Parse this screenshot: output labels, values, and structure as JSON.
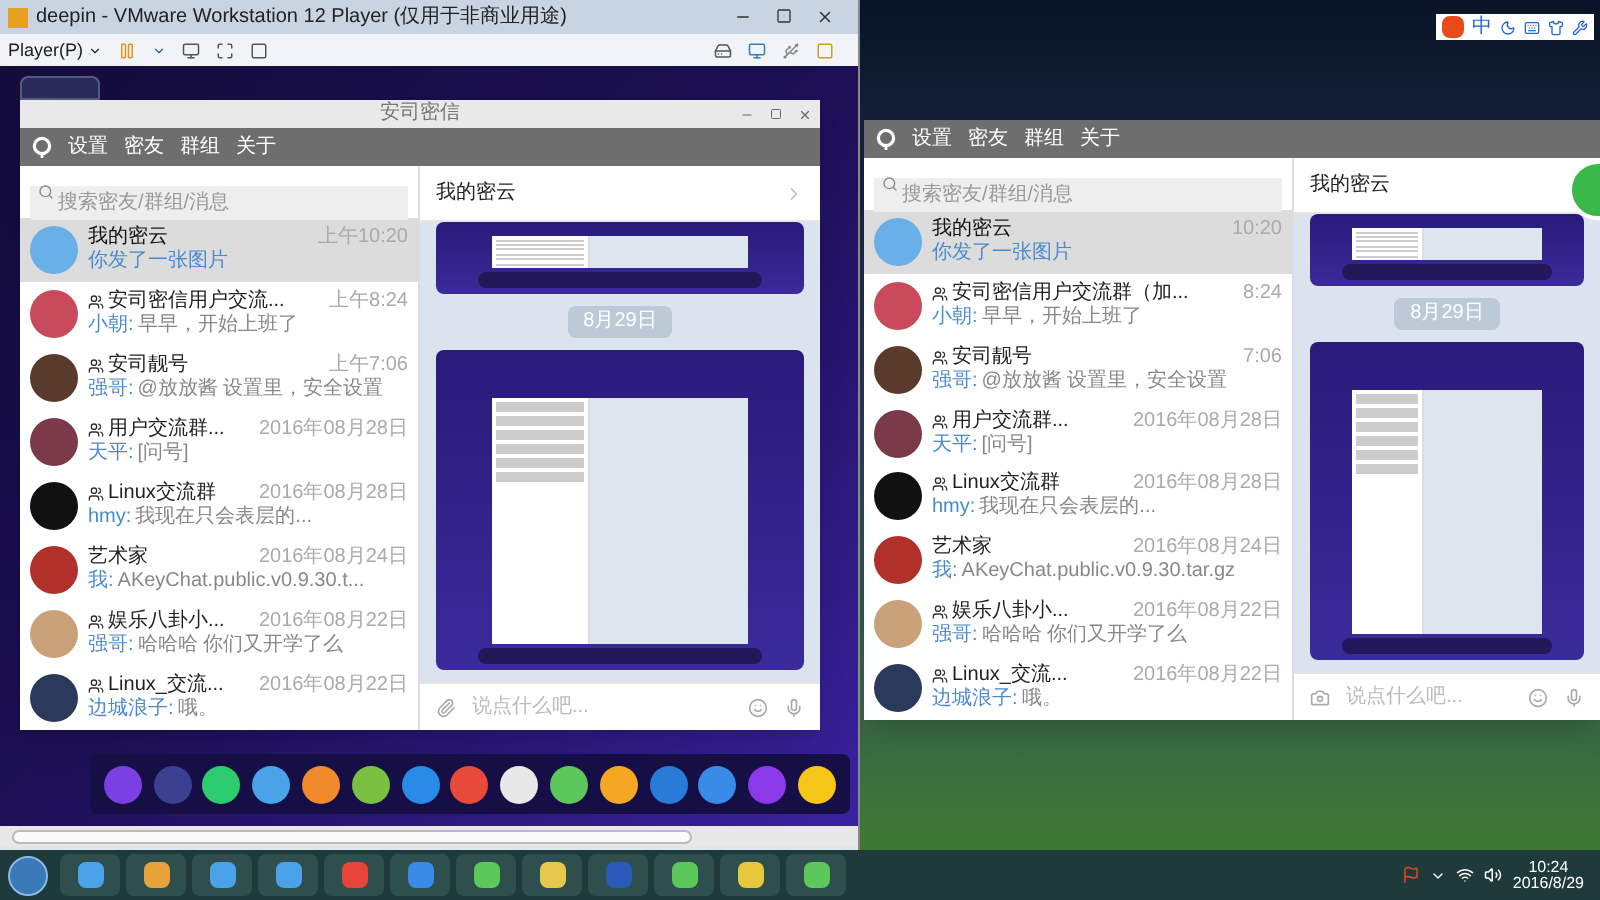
{
  "vmware_window": {
    "title": "deepin - VMware Workstation 12 Player (仅用于非商业用途)",
    "menu_label": "Player(P)"
  },
  "left_app": {
    "title": "安司密信",
    "menu": [
      "设置",
      "密友",
      "群组",
      "关于"
    ],
    "search": {
      "placeholder": "搜索密友/群组/消息"
    },
    "chats": [
      {
        "name": "我的密云",
        "group": false,
        "time": "上午10:20",
        "preview": "你发了一张图片",
        "selected": true
      },
      {
        "name": "安司密信用户交流...",
        "group": true,
        "time": "上午8:24",
        "sender": "小朝:",
        "preview": "早早，开始上班了",
        "selected": false
      },
      {
        "name": "安司靓号",
        "group": true,
        "time": "上午7:06",
        "sender": "强哥:",
        "preview": "@放放酱 设置里，安全设置",
        "selected": false
      },
      {
        "name": "用户交流群...",
        "group": true,
        "time": "2016年08月28日",
        "sender": "天平:",
        "preview": "[问号]",
        "selected": false
      },
      {
        "name": "Linux交流群",
        "group": true,
        "time": "2016年08月28日",
        "sender": "hmy:",
        "preview": "我现在只会表层的...",
        "selected": false
      },
      {
        "name": "艺术家",
        "group": false,
        "time": "2016年08月24日",
        "sender": "我:",
        "preview": "AKeyChat.public.v0.9.30.t...",
        "selected": false
      },
      {
        "name": "娱乐八卦小...",
        "group": true,
        "time": "2016年08月22日",
        "sender": "强哥:",
        "preview": "哈哈哈 你们又开学了么",
        "selected": false
      },
      {
        "name": "Linux_交流...",
        "group": true,
        "time": "2016年08月22日",
        "sender": "边城浪子:",
        "preview": "哦。",
        "selected": false
      }
    ],
    "conversation": {
      "title": "我的密云",
      "date_badge": "8月29日",
      "input": {
        "placeholder": "说点什么吧..."
      }
    }
  },
  "right_app": {
    "menu": [
      "设置",
      "密友",
      "群组",
      "关于"
    ],
    "search": {
      "placeholder": "搜索密友/群组/消息"
    },
    "chats": [
      {
        "name": "我的密云",
        "group": false,
        "time": "10:20",
        "preview": "你发了一张图片",
        "selected": true
      },
      {
        "name": "安司密信用户交流群（加...",
        "group": true,
        "time": "8:24",
        "sender": "小朝:",
        "preview": "早早，开始上班了",
        "selected": false
      },
      {
        "name": "安司靓号",
        "group": true,
        "time": "7:06",
        "sender": "强哥:",
        "preview": "@放放酱 设置里，安全设置",
        "selected": false
      },
      {
        "name": "用户交流群...",
        "group": true,
        "time": "2016年08月28日",
        "sender": "天平:",
        "preview": "[问号]",
        "selected": false
      },
      {
        "name": "Linux交流群",
        "group": true,
        "time": "2016年08月28日",
        "sender": "hmy:",
        "preview": "我现在只会表层的...",
        "selected": false
      },
      {
        "name": "艺术家",
        "group": false,
        "time": "2016年08月24日",
        "sender": "我:",
        "preview": "AKeyChat.public.v0.9.30.tar.gz",
        "selected": false
      },
      {
        "name": "娱乐八卦小...",
        "group": true,
        "time": "2016年08月22日",
        "sender": "强哥:",
        "preview": "哈哈哈 你们又开学了么",
        "selected": false
      },
      {
        "name": "Linux_交流...",
        "group": true,
        "time": "2016年08月22日",
        "sender": "边城浪子:",
        "preview": "哦。",
        "selected": false
      }
    ],
    "conversation": {
      "title": "我的密云",
      "date_badge": "8月29日",
      "input": {
        "placeholder": "说点什么吧..."
      }
    }
  },
  "ime_bar": {
    "label": "中"
  },
  "taskbar": {
    "time": "10:24",
    "date": "2016/8/29"
  }
}
